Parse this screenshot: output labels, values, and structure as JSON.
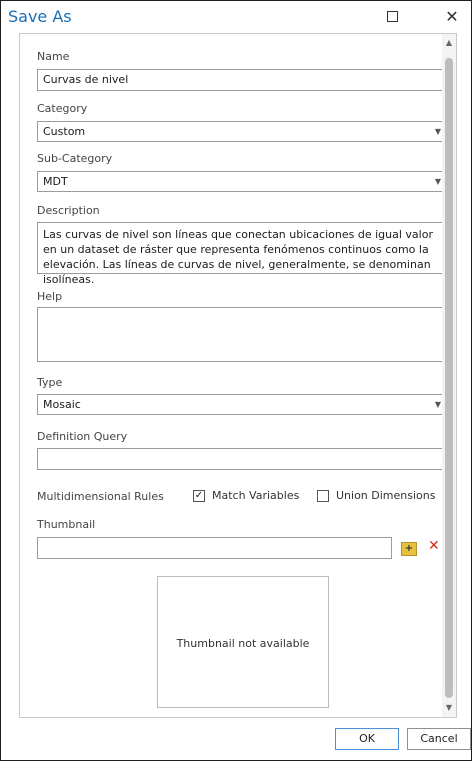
{
  "window": {
    "title": "Save As",
    "maximize_icon": "maximize-icon",
    "close_icon": "close-icon"
  },
  "form": {
    "name_label": "Name",
    "name_value": "Curvas de nivel",
    "category_label": "Category",
    "category_value": "Custom",
    "subcategory_label": "Sub-Category",
    "subcategory_value": "MDT",
    "description_label": "Description",
    "description_value": "Las curvas de nivel son líneas que conectan ubicaciones de igual valor en un dataset de ráster que representa fenómenos continuos como la elevación. Las líneas de curvas de nivel, generalmente, se denominan isolíneas.",
    "help_label": "Help",
    "help_value": "",
    "type_label": "Type",
    "type_value": "Mosaic",
    "definition_query_label": "Definition Query",
    "definition_query_value": "",
    "multidimensional_label": "Multidimensional Rules",
    "match_variables_label": "Match Variables",
    "match_variables_checked": true,
    "union_dimensions_label": "Union Dimensions",
    "union_dimensions_checked": false,
    "thumbnail_label": "Thumbnail",
    "thumbnail_value": "",
    "thumbnail_placeholder": "Thumbnail not available"
  },
  "buttons": {
    "ok": "OK",
    "cancel": "Cancel"
  },
  "colors": {
    "title": "#1a6fb5",
    "delete_icon": "#d1341e",
    "folder_icon": "#e6c13c"
  }
}
